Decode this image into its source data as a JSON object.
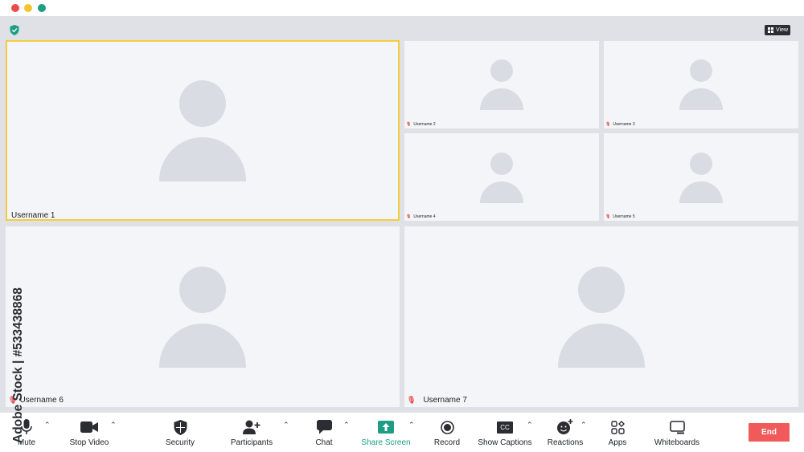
{
  "window": {
    "controls": [
      "close",
      "minimize",
      "maximize"
    ],
    "colors": {
      "close": "#ee4c4c",
      "minimize": "#f5c330",
      "maximize": "#1b9e84"
    }
  },
  "header": {
    "security_icon": "shield-check-icon",
    "view_label": "View"
  },
  "participants": [
    {
      "name": "Username 1",
      "muted": false,
      "active_speaker": true
    },
    {
      "name": "Username 2",
      "muted": true,
      "active_speaker": false
    },
    {
      "name": "Username 3",
      "muted": true,
      "active_speaker": false
    },
    {
      "name": "Username 4",
      "muted": true,
      "active_speaker": false
    },
    {
      "name": "Username 5",
      "muted": true,
      "active_speaker": false
    },
    {
      "name": "Username 6",
      "muted": true,
      "active_speaker": false
    },
    {
      "name": "Username 7",
      "muted": true,
      "active_speaker": false
    }
  ],
  "toolbar": {
    "mute": "Mute",
    "stop_video": "Stop Video",
    "security": "Security",
    "participants": "Participants",
    "chat": "Chat",
    "share_screen": "Share Screen",
    "record": "Record",
    "show_captions": "Show Captions",
    "captions_badge": "CC",
    "reactions": "Reactions",
    "apps": "Apps",
    "whiteboards": "Whiteboards",
    "end": "End"
  },
  "watermark": {
    "text": "Adobe Stock | #533438868"
  },
  "colors": {
    "accent_green": "#1b9e84",
    "active_border": "#f3cd3c",
    "end_button": "#f05a5a",
    "muted_mic": "#e84a4a"
  }
}
